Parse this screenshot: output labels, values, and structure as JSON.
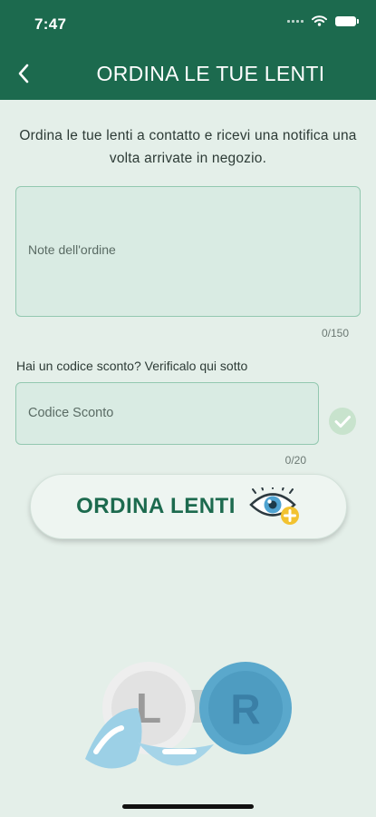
{
  "status_bar": {
    "time": "7:47"
  },
  "header": {
    "title": "ORDINA LE TUE LENTI"
  },
  "intro": {
    "text": "Ordina le tue lenti a contatto e ricevi una notifica una volta arrivate in negozio."
  },
  "notes": {
    "placeholder": "Note dell'ordine",
    "counter": "0/150"
  },
  "discount": {
    "label": "Hai un codice sconto? Verificalo qui sotto",
    "placeholder": "Codice Sconto",
    "counter": "0/20"
  },
  "order_button": {
    "label": "ORDINA LENTI"
  },
  "illustration": {
    "left_letter": "L",
    "right_letter": "R"
  },
  "colors": {
    "brand_green": "#1c6a4e",
    "background": "#e4efe9",
    "field_border": "#93c8b0",
    "lens_blue": "#5aa8cc",
    "accent_yellow": "#f2c230"
  },
  "icons": [
    "back-chevron-icon",
    "wifi-icon",
    "battery-icon",
    "check-circle-icon",
    "eye-plus-icon"
  ]
}
